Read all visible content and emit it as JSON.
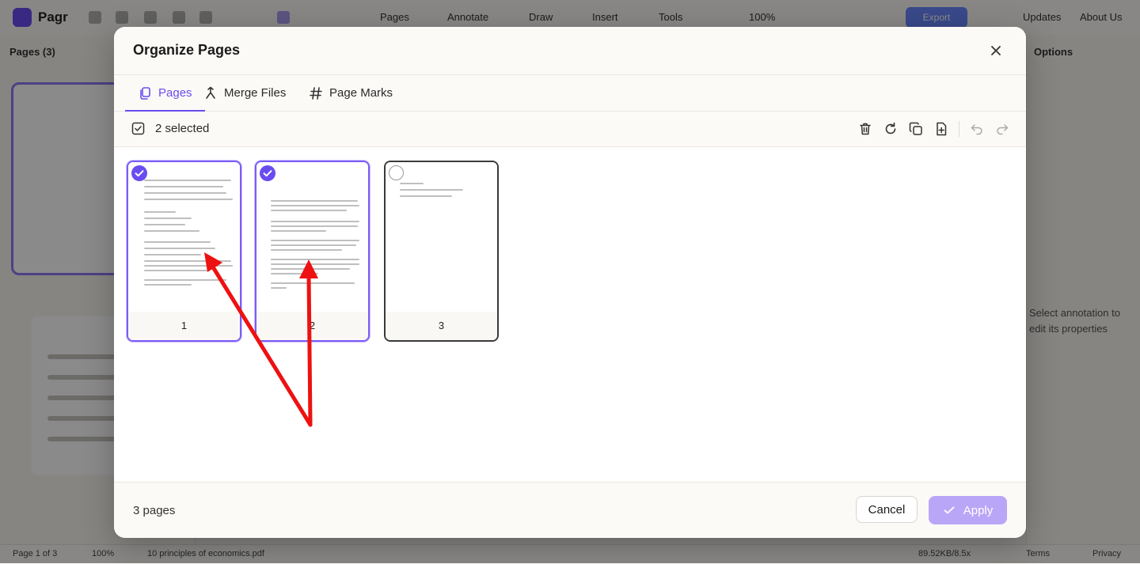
{
  "background_app": {
    "brand": "Pagr",
    "menus": [
      "Pages",
      "Annotate",
      "Draw",
      "Insert",
      "Tools"
    ],
    "zoom": "100%",
    "export_label": "Export",
    "nav_links": [
      "Updates",
      "About Us"
    ],
    "sidebar_title": "Pages (3)",
    "right_panel_title": "Options",
    "right_panel_hint": "Select annotation to edit its properties",
    "status": {
      "page": "Page 1 of 3",
      "zoom": "100%",
      "file": "10 principles of economics.pdf",
      "size": "89.52KB/8.5x",
      "terms": "Terms",
      "privacy": "Privacy"
    }
  },
  "modal": {
    "title": "Organize Pages",
    "tabs": [
      {
        "label": "Pages",
        "icon": "pages-icon",
        "active": true
      },
      {
        "label": "Merge Files",
        "icon": "merge-icon",
        "active": false
      },
      {
        "label": "Page Marks",
        "icon": "hash-icon",
        "active": false
      }
    ],
    "toolbar": {
      "selected_text": "2 selected",
      "actions": [
        "delete-icon",
        "rotate-icon",
        "duplicate-icon",
        "insert-page-icon",
        "undo-icon",
        "redo-icon"
      ]
    },
    "pages": [
      {
        "number": "1",
        "selected": true
      },
      {
        "number": "2",
        "selected": true
      },
      {
        "number": "3",
        "selected": false
      }
    ],
    "footer": {
      "page_count": "3 pages",
      "cancel_label": "Cancel",
      "apply_label": "Apply"
    }
  },
  "colors": {
    "accent": "#6a4cf0",
    "apply_disabled": "#b9a6f7",
    "annotation_arrow": "#ee1111"
  }
}
